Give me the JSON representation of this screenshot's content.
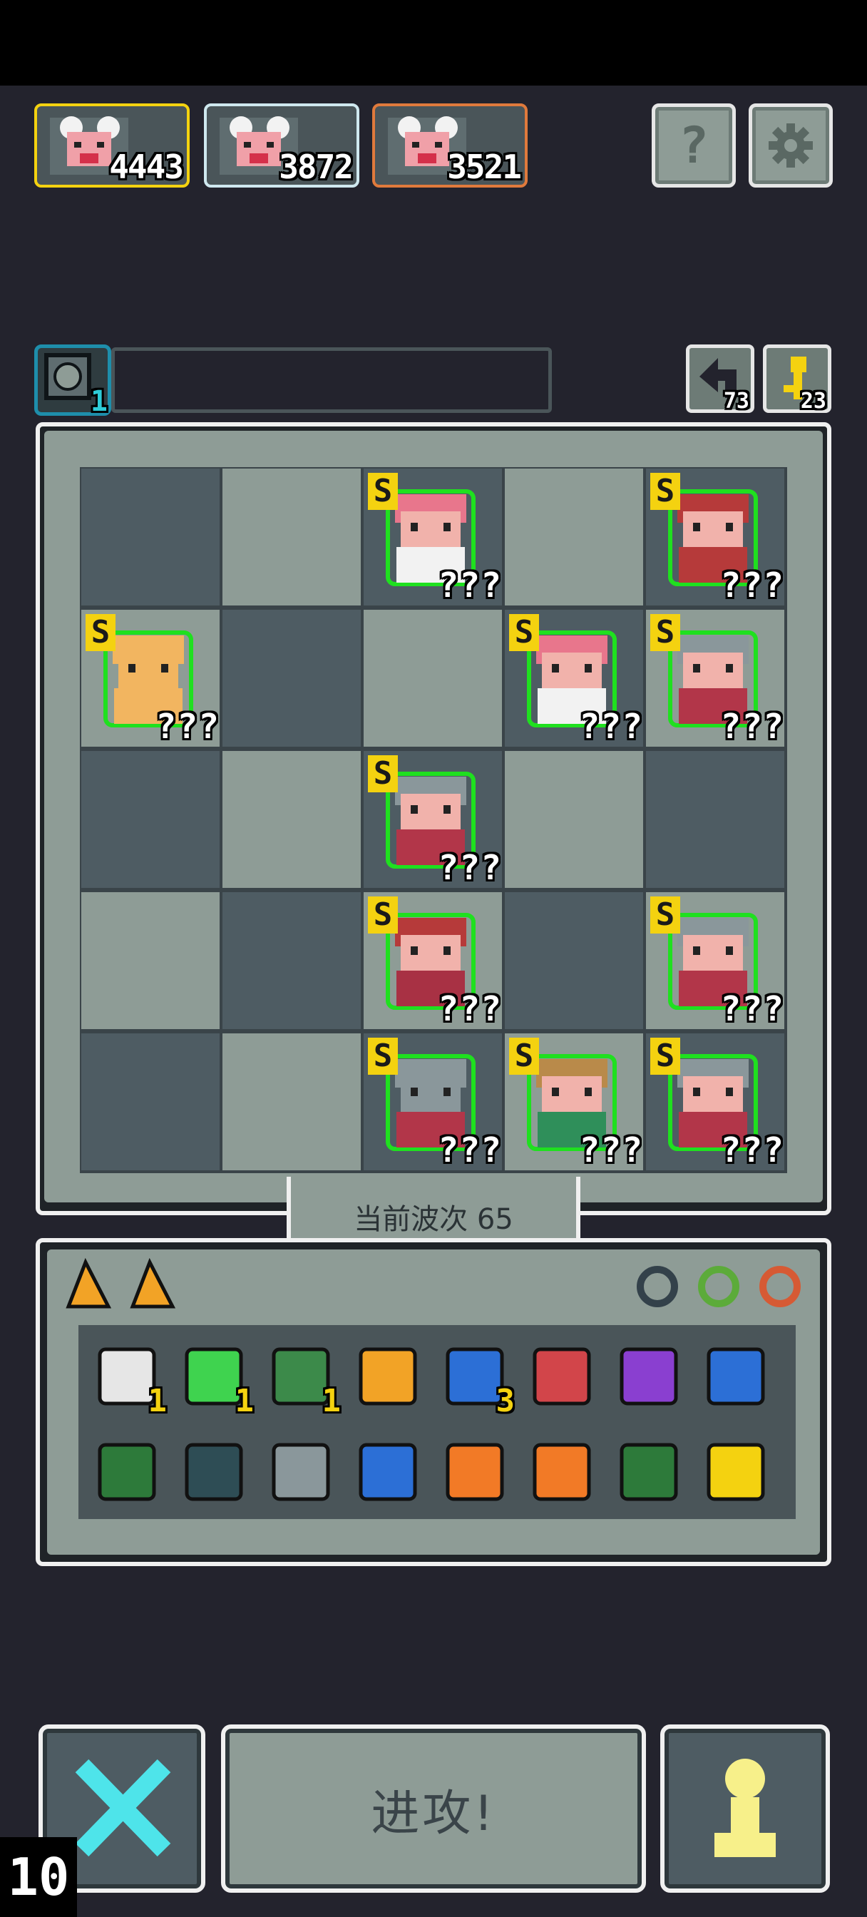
{
  "enemies": [
    {
      "power": "4443",
      "border": "#f4d210"
    },
    {
      "power": "3872",
      "border": "#cfe8ef"
    },
    {
      "power": "3521",
      "border": "#e07a3c"
    }
  ],
  "header": {
    "help_icon": "?",
    "settings_icon": "gear"
  },
  "progress": {
    "level": "1",
    "undo_count": "73",
    "key_count": "23"
  },
  "board": {
    "units": [
      {
        "row": 0,
        "col": 2,
        "rank": "S",
        "level": "???",
        "type": "archer-girl"
      },
      {
        "row": 0,
        "col": 4,
        "rank": "S",
        "level": "???",
        "type": "chief"
      },
      {
        "row": 1,
        "col": 0,
        "rank": "S",
        "level": "???",
        "type": "golem"
      },
      {
        "row": 1,
        "col": 3,
        "rank": "S",
        "level": "???",
        "type": "archer-girl"
      },
      {
        "row": 1,
        "col": 4,
        "rank": "S",
        "level": "???",
        "type": "knight"
      },
      {
        "row": 2,
        "col": 2,
        "rank": "S",
        "level": "???",
        "type": "knight"
      },
      {
        "row": 3,
        "col": 2,
        "rank": "S",
        "level": "???",
        "type": "crossbowman"
      },
      {
        "row": 3,
        "col": 4,
        "rank": "S",
        "level": "???",
        "type": "knight"
      },
      {
        "row": 4,
        "col": 2,
        "rank": "S",
        "level": "???",
        "type": "heavy-knight"
      },
      {
        "row": 4,
        "col": 3,
        "rank": "S",
        "level": "???",
        "type": "ranger"
      },
      {
        "row": 4,
        "col": 4,
        "rank": "S",
        "level": "???",
        "type": "knight"
      }
    ],
    "wave_label": "当前波次 65"
  },
  "inventory": {
    "tabs": [
      "cheese-icon",
      "cheese-icon"
    ],
    "rings": [
      "ring-dark",
      "ring-green",
      "ring-orange"
    ],
    "row1": [
      {
        "name": "scroll-icon",
        "count": "1"
      },
      {
        "name": "emerald-shield-icon",
        "count": "1"
      },
      {
        "name": "hooded-figure-icon",
        "count": "1"
      },
      {
        "name": "trident-icon",
        "count": ""
      },
      {
        "name": "hourglass-icon",
        "count": "3"
      },
      {
        "name": "arrow-icon",
        "count": ""
      },
      {
        "name": "purple-key-icon",
        "count": ""
      },
      {
        "name": "water-drop-icon",
        "count": ""
      }
    ],
    "row2": [
      {
        "name": "green-rune-tile-icon",
        "count": ""
      },
      {
        "name": "bell-icon",
        "count": ""
      },
      {
        "name": "spike-trap-icon",
        "count": ""
      },
      {
        "name": "water-tile-icon",
        "count": ""
      },
      {
        "name": "fire-tile-icon",
        "count": ""
      },
      {
        "name": "fire-tile-icon",
        "count": ""
      },
      {
        "name": "green-rune-tile-icon",
        "count": ""
      },
      {
        "name": "golden-chalice-icon",
        "count": ""
      }
    ]
  },
  "actions": {
    "attack_label": "进攻!",
    "counter": "10"
  }
}
